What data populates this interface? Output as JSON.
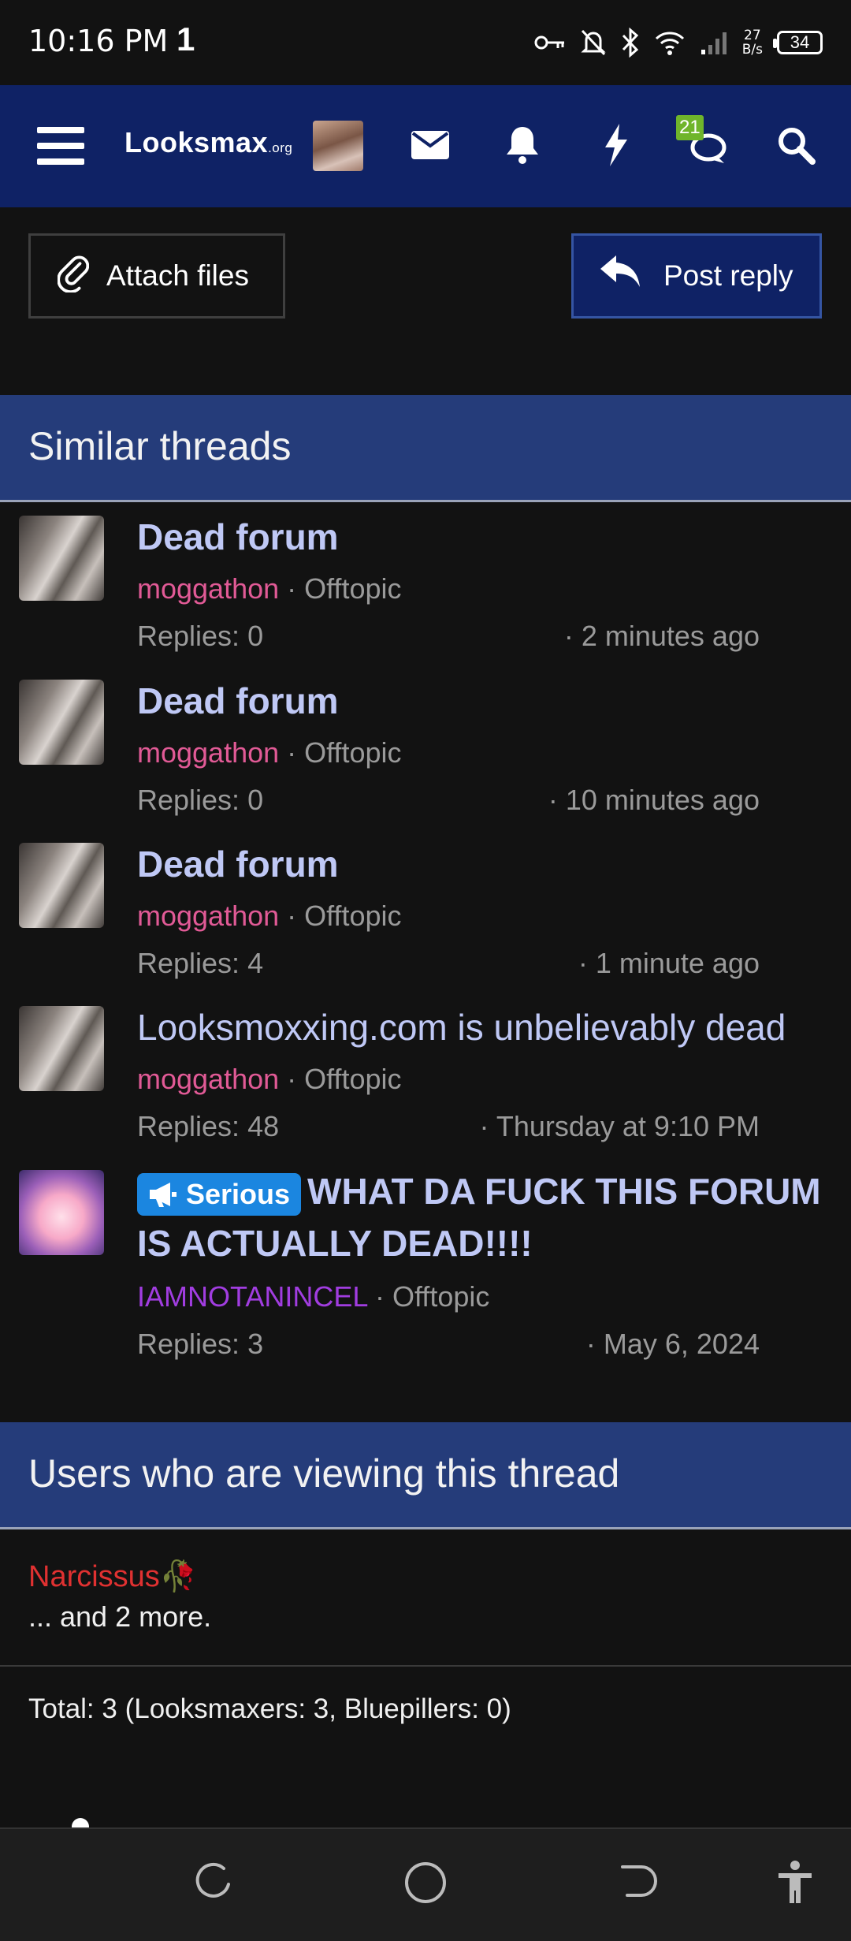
{
  "status_bar": {
    "time": "10:16 PM",
    "carrier_mark": "1",
    "net_speed_value": "27",
    "net_speed_unit": "B/s",
    "battery": "34"
  },
  "nav": {
    "logo_main": "Looksmax",
    "logo_suffix": ".org",
    "conversations_badge": "21"
  },
  "actions": {
    "attach_label": "Attach files",
    "reply_label": "Post reply"
  },
  "similar": {
    "header": "Similar threads",
    "threads": [
      {
        "title": "Dead forum",
        "author": "moggathon",
        "forum": "Offtopic",
        "replies": "Replies: 0",
        "date": "2 minutes ago"
      },
      {
        "title": "Dead forum",
        "author": "moggathon",
        "forum": "Offtopic",
        "replies": "Replies: 0",
        "date": "10 minutes ago"
      },
      {
        "title": "Dead forum",
        "author": "moggathon",
        "forum": "Offtopic",
        "replies": "Replies: 4",
        "date": "1 minute ago"
      },
      {
        "title": "Looksmoxxing.com is unbelievably dead",
        "author": "moggathon",
        "forum": "Offtopic",
        "replies": "Replies: 48",
        "date": "Thursday at 9:10 PM"
      },
      {
        "prefix": "Serious",
        "title_line1": "WHAT DA FUCK THIS FORUM",
        "title_line2": "IS ACTUALLY DEAD!!!!",
        "author": "IAMNOTANINCEL",
        "forum": "Offtopic",
        "replies": "Replies: 3",
        "date": "May 6, 2024"
      }
    ]
  },
  "viewing": {
    "header": "Users who are viewing this thread",
    "user": "Narcissus🥀",
    "more": "... and 2 more.",
    "total": "Total: 3 (Looksmaxers: 3, Bluepillers: 0)"
  }
}
